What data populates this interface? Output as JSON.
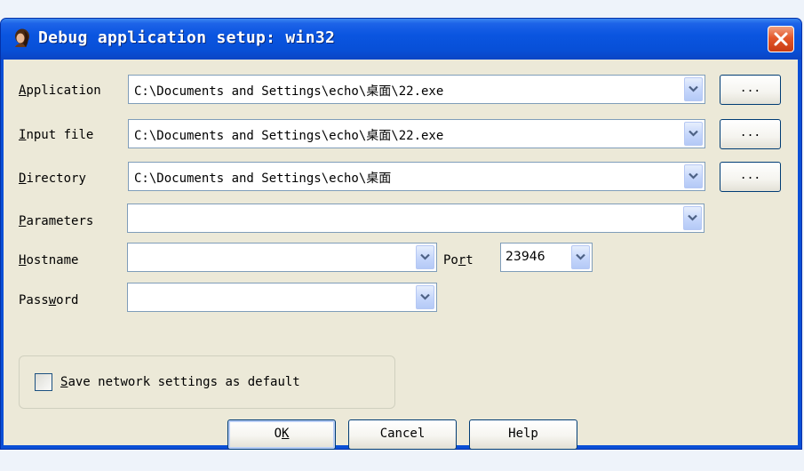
{
  "dialog": {
    "title": "Debug application setup: win32",
    "app_icon": "ida-woman-icon",
    "close_icon": "close-x-icon"
  },
  "fields": {
    "application": {
      "label_mn": "A",
      "label_rest": "pplication",
      "value": "C:\\Documents and Settings\\echo\\桌面\\22.exe",
      "browse": "..."
    },
    "input_file": {
      "label_mn": "I",
      "label_rest": "nput file",
      "value": "C:\\Documents and Settings\\echo\\桌面\\22.exe",
      "browse": "..."
    },
    "directory": {
      "label_mn": "D",
      "label_rest": "irectory",
      "value": "C:\\Documents and Settings\\echo\\桌面",
      "browse": "..."
    },
    "parameters": {
      "label_mn": "P",
      "label_rest": "arameters",
      "value": ""
    },
    "hostname": {
      "label_mn": "H",
      "label_rest": "ostname",
      "value": ""
    },
    "port": {
      "label_pre": "Po",
      "label_mn": "r",
      "label_rest": "t",
      "value": "23946"
    },
    "password": {
      "label_pre": "Pass",
      "label_mn": "w",
      "label_rest": "ord",
      "value": ""
    }
  },
  "save_default": {
    "label_mn": "S",
    "label_rest": "ave network settings as default",
    "checked": false
  },
  "buttons": {
    "ok_pre": "O",
    "ok_mn": "K",
    "cancel": "Cancel",
    "help": "Help"
  },
  "colors": {
    "title_bar": "#0a55e0",
    "client_bg": "#ece9d8",
    "close_btn": "#e4582a"
  }
}
